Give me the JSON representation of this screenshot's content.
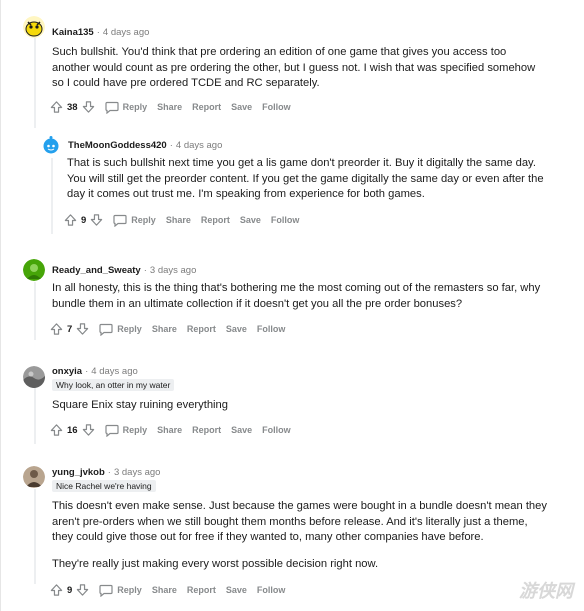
{
  "comments": [
    {
      "username": "Kaina135",
      "time": "4 days ago",
      "flair": "",
      "paragraphs": [
        "Such bullshit. You'd think that pre ordering an edition of one game that gives you access too another would count as pre ordering the other, but I guess not. I wish that was specified somehow so I could have pre ordered TCDE and RC separately."
      ],
      "votes": "38",
      "actions": {
        "reply": "Reply",
        "share": "Share",
        "report": "Report",
        "save": "Save",
        "follow": "Follow"
      },
      "avatar_color": "#f5d90a"
    },
    {
      "username": "TheMoonGoddess420",
      "time": "4 days ago",
      "flair": "",
      "paragraphs": [
        "That is such bullshit next time you get a lis game don't preorder it. Buy it digitally the same day. You will still get the preorder content. If you get the game digitally the same day or even after the day it comes out trust me. I'm speaking from experience for both games."
      ],
      "votes": "9",
      "actions": {
        "reply": "Reply",
        "share": "Share",
        "report": "Report",
        "save": "Save",
        "follow": "Follow"
      },
      "avatar_color": "#24a0ed"
    },
    {
      "username": "Ready_and_Sweaty",
      "time": "3 days ago",
      "flair": "",
      "paragraphs": [
        "In all honesty, this is the thing that's bothering me the most coming out of the remasters so far, why bundle them in an ultimate collection if it doesn't get you all the pre order bonuses?"
      ],
      "votes": "7",
      "actions": {
        "reply": "Reply",
        "share": "Share",
        "report": "Report",
        "save": "Save",
        "follow": "Follow"
      },
      "avatar_color": "#46a508"
    },
    {
      "username": "onxyia",
      "time": "4 days ago",
      "flair": "Why look, an otter in my water",
      "paragraphs": [
        "Square Enix stay ruining everything"
      ],
      "votes": "16",
      "actions": {
        "reply": "Reply",
        "share": "Share",
        "report": "Report",
        "save": "Save",
        "follow": "Follow"
      },
      "avatar_color": "#6b6b6b"
    },
    {
      "username": "yung_jvkob",
      "time": "3 days ago",
      "flair": "Nice Rachel we're having",
      "paragraphs": [
        "This doesn't even make sense. Just because the games were bought in a bundle doesn't mean they aren't pre-orders when we still bought them months before release. And it's literally just a theme, they could give those out for free if they wanted to, many other companies have before.",
        "They're really just making every worst possible decision right now."
      ],
      "votes": "9",
      "actions": {
        "reply": "Reply",
        "share": "Share",
        "report": "Report",
        "save": "Save",
        "follow": "Follow"
      },
      "avatar_color": "#8a7a6a"
    }
  ],
  "watermark": "游侠网"
}
